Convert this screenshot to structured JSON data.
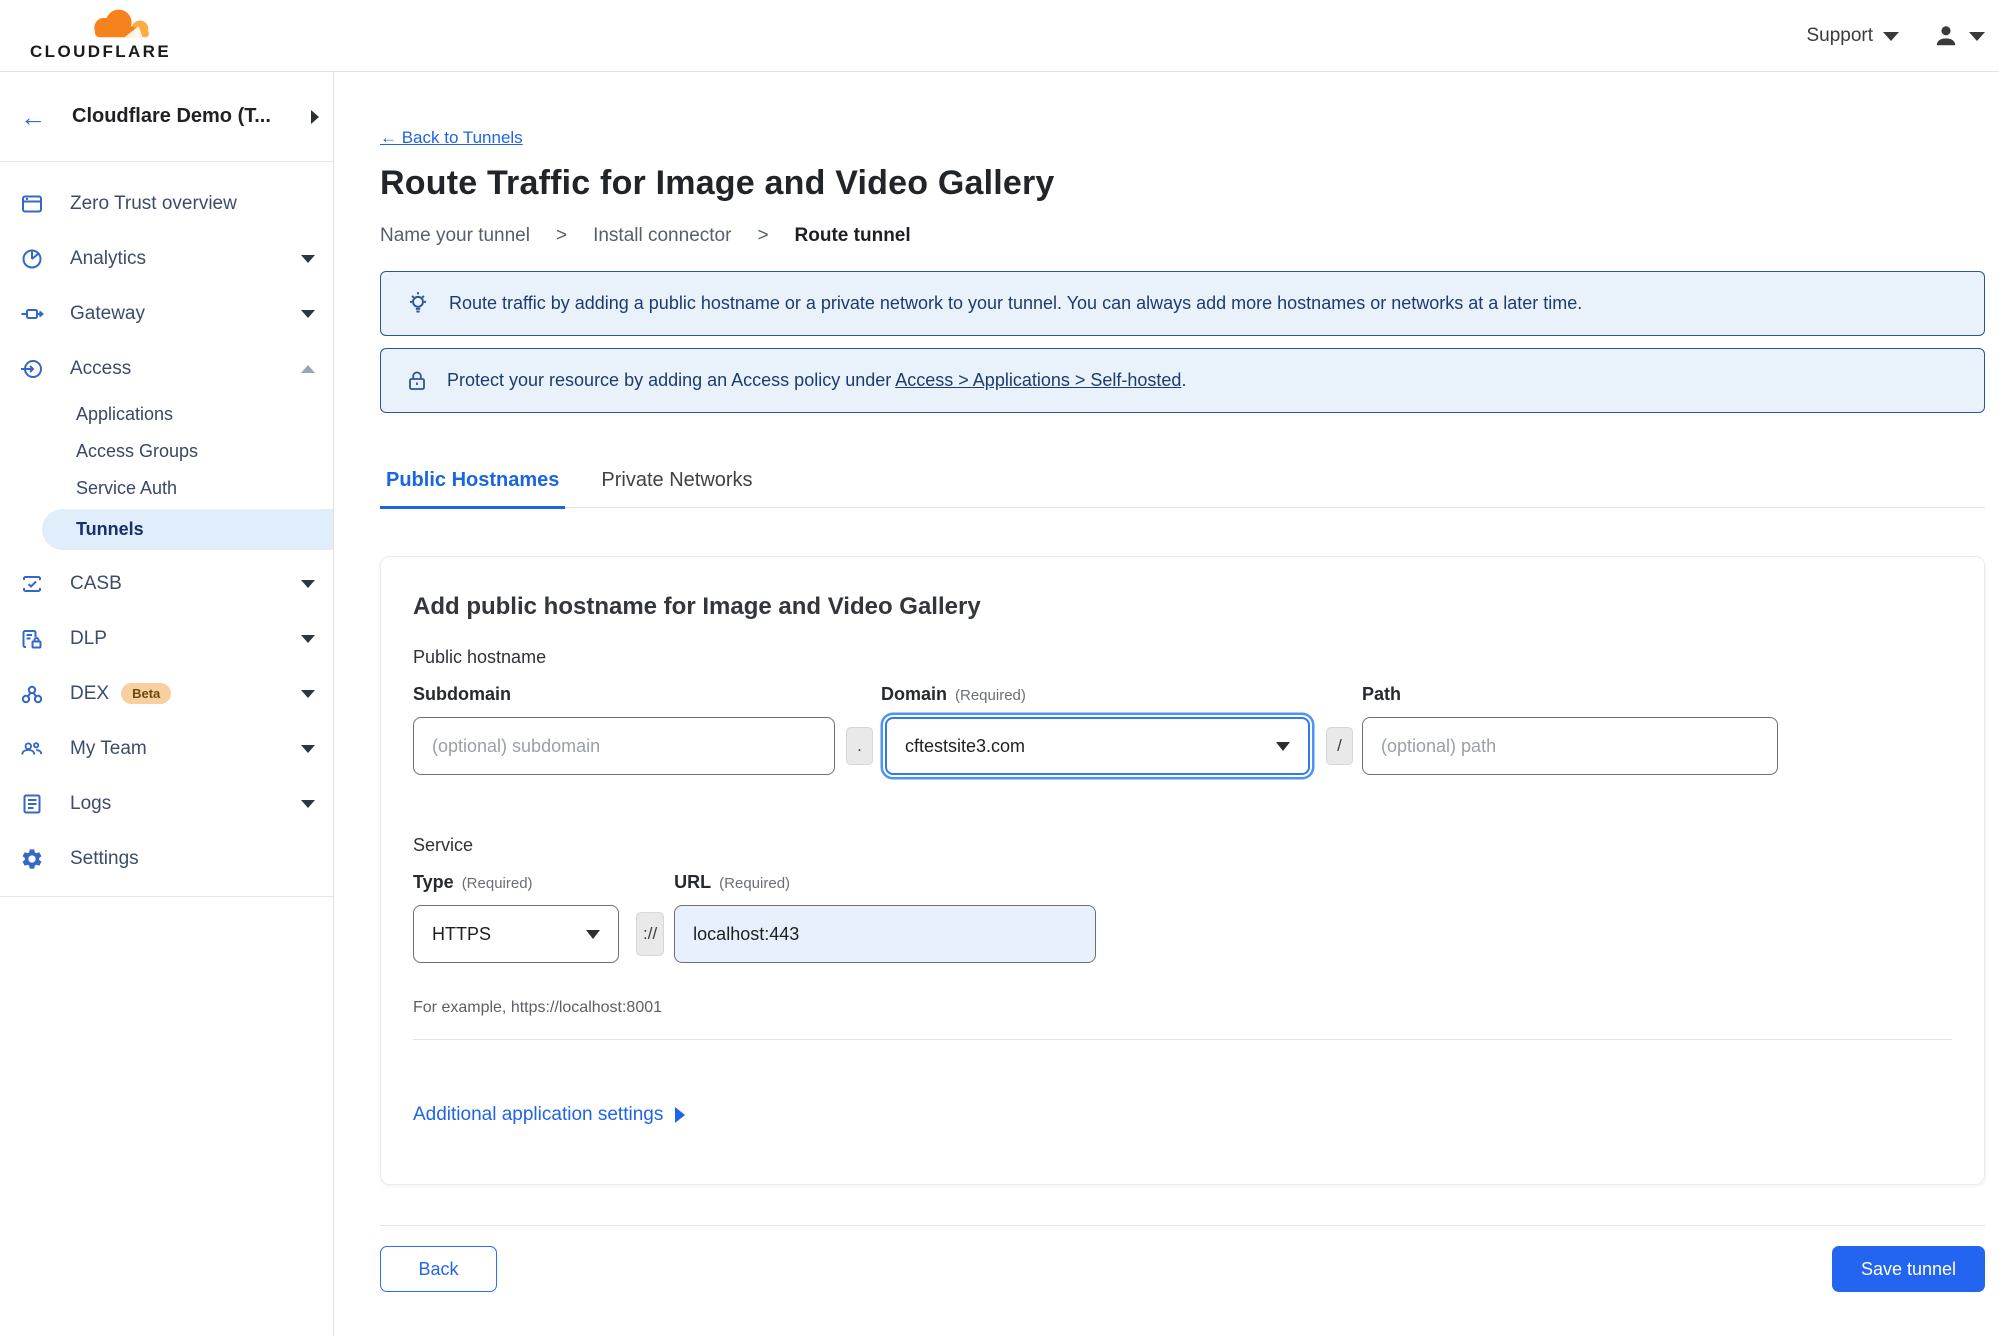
{
  "topbar": {
    "brand": "CLOUDFLARE",
    "support_label": "Support"
  },
  "colors": {
    "accent_blue": "#2365f0",
    "link_blue": "#1f64e8",
    "banner_bg": "#e9f1fb",
    "banner_border": "#2b5694",
    "active_pill_bg": "#e0edfa",
    "logo_orange": "#f6821f",
    "logo_orange_light": "#fbad41"
  },
  "sidebar": {
    "account_name": "Cloudflare Demo (T...",
    "items": [
      {
        "label": "Zero Trust overview",
        "icon": "window-icon",
        "chevron": "none"
      },
      {
        "label": "Analytics",
        "icon": "pie-chart-icon",
        "chevron": "down"
      },
      {
        "label": "Gateway",
        "icon": "gateway-icon",
        "chevron": "down"
      },
      {
        "label": "Access",
        "icon": "access-icon",
        "chevron": "up"
      },
      {
        "label": "CASB",
        "icon": "casb-check-icon",
        "chevron": "down"
      },
      {
        "label": "DLP",
        "icon": "dlp-doc-lock-icon",
        "chevron": "down"
      },
      {
        "label": "DEX",
        "icon": "dex-network-icon",
        "chevron": "down",
        "badge": "Beta"
      },
      {
        "label": "My Team",
        "icon": "people-icon",
        "chevron": "down"
      },
      {
        "label": "Logs",
        "icon": "logs-doc-icon",
        "chevron": "down"
      },
      {
        "label": "Settings",
        "icon": "gear-icon",
        "chevron": "none"
      }
    ],
    "access_children": [
      {
        "label": "Applications",
        "active": false
      },
      {
        "label": "Access Groups",
        "active": false
      },
      {
        "label": "Service Auth",
        "active": false
      },
      {
        "label": "Tunnels",
        "active": true
      }
    ]
  },
  "main": {
    "back_link": "← Back to Tunnels",
    "title": "Route Traffic for Image and Video Gallery",
    "steps": {
      "s1": "Name your tunnel",
      "s2": "Install connector",
      "s3": "Route tunnel",
      "separator": ">"
    },
    "banners": {
      "tip": {
        "icon": "lightbulb-icon",
        "text": "Route traffic by adding a public hostname or a private network to your tunnel. You can always add more hostnames or networks at a later time."
      },
      "protect": {
        "icon": "lock-icon",
        "prefix": "Protect your resource by adding an Access policy under ",
        "link": "Access > Applications > Self-hosted",
        "suffix": "."
      }
    },
    "tabs": {
      "tab1": "Public Hostnames",
      "tab2": "Private Networks"
    },
    "form": {
      "heading": "Add public hostname for Image and Video Gallery",
      "public_hostname_label": "Public hostname",
      "subdomain": {
        "label": "Subdomain",
        "placeholder": "(optional) subdomain"
      },
      "domain": {
        "label": "Domain",
        "required": "(Required)",
        "value": "cftestsite3.com"
      },
      "path": {
        "label": "Path",
        "placeholder": "(optional) path"
      },
      "separators": {
        "dot": ".",
        "slash": "/",
        "scheme": "://"
      },
      "service_label": "Service",
      "type": {
        "label": "Type",
        "required": "(Required)",
        "value": "HTTPS"
      },
      "url": {
        "label": "URL",
        "required": "(Required)",
        "value": "localhost:443"
      },
      "example": "For example, https://localhost:8001",
      "additional_settings": "Additional application settings"
    },
    "footer": {
      "back": "Back",
      "save": "Save tunnel"
    }
  }
}
